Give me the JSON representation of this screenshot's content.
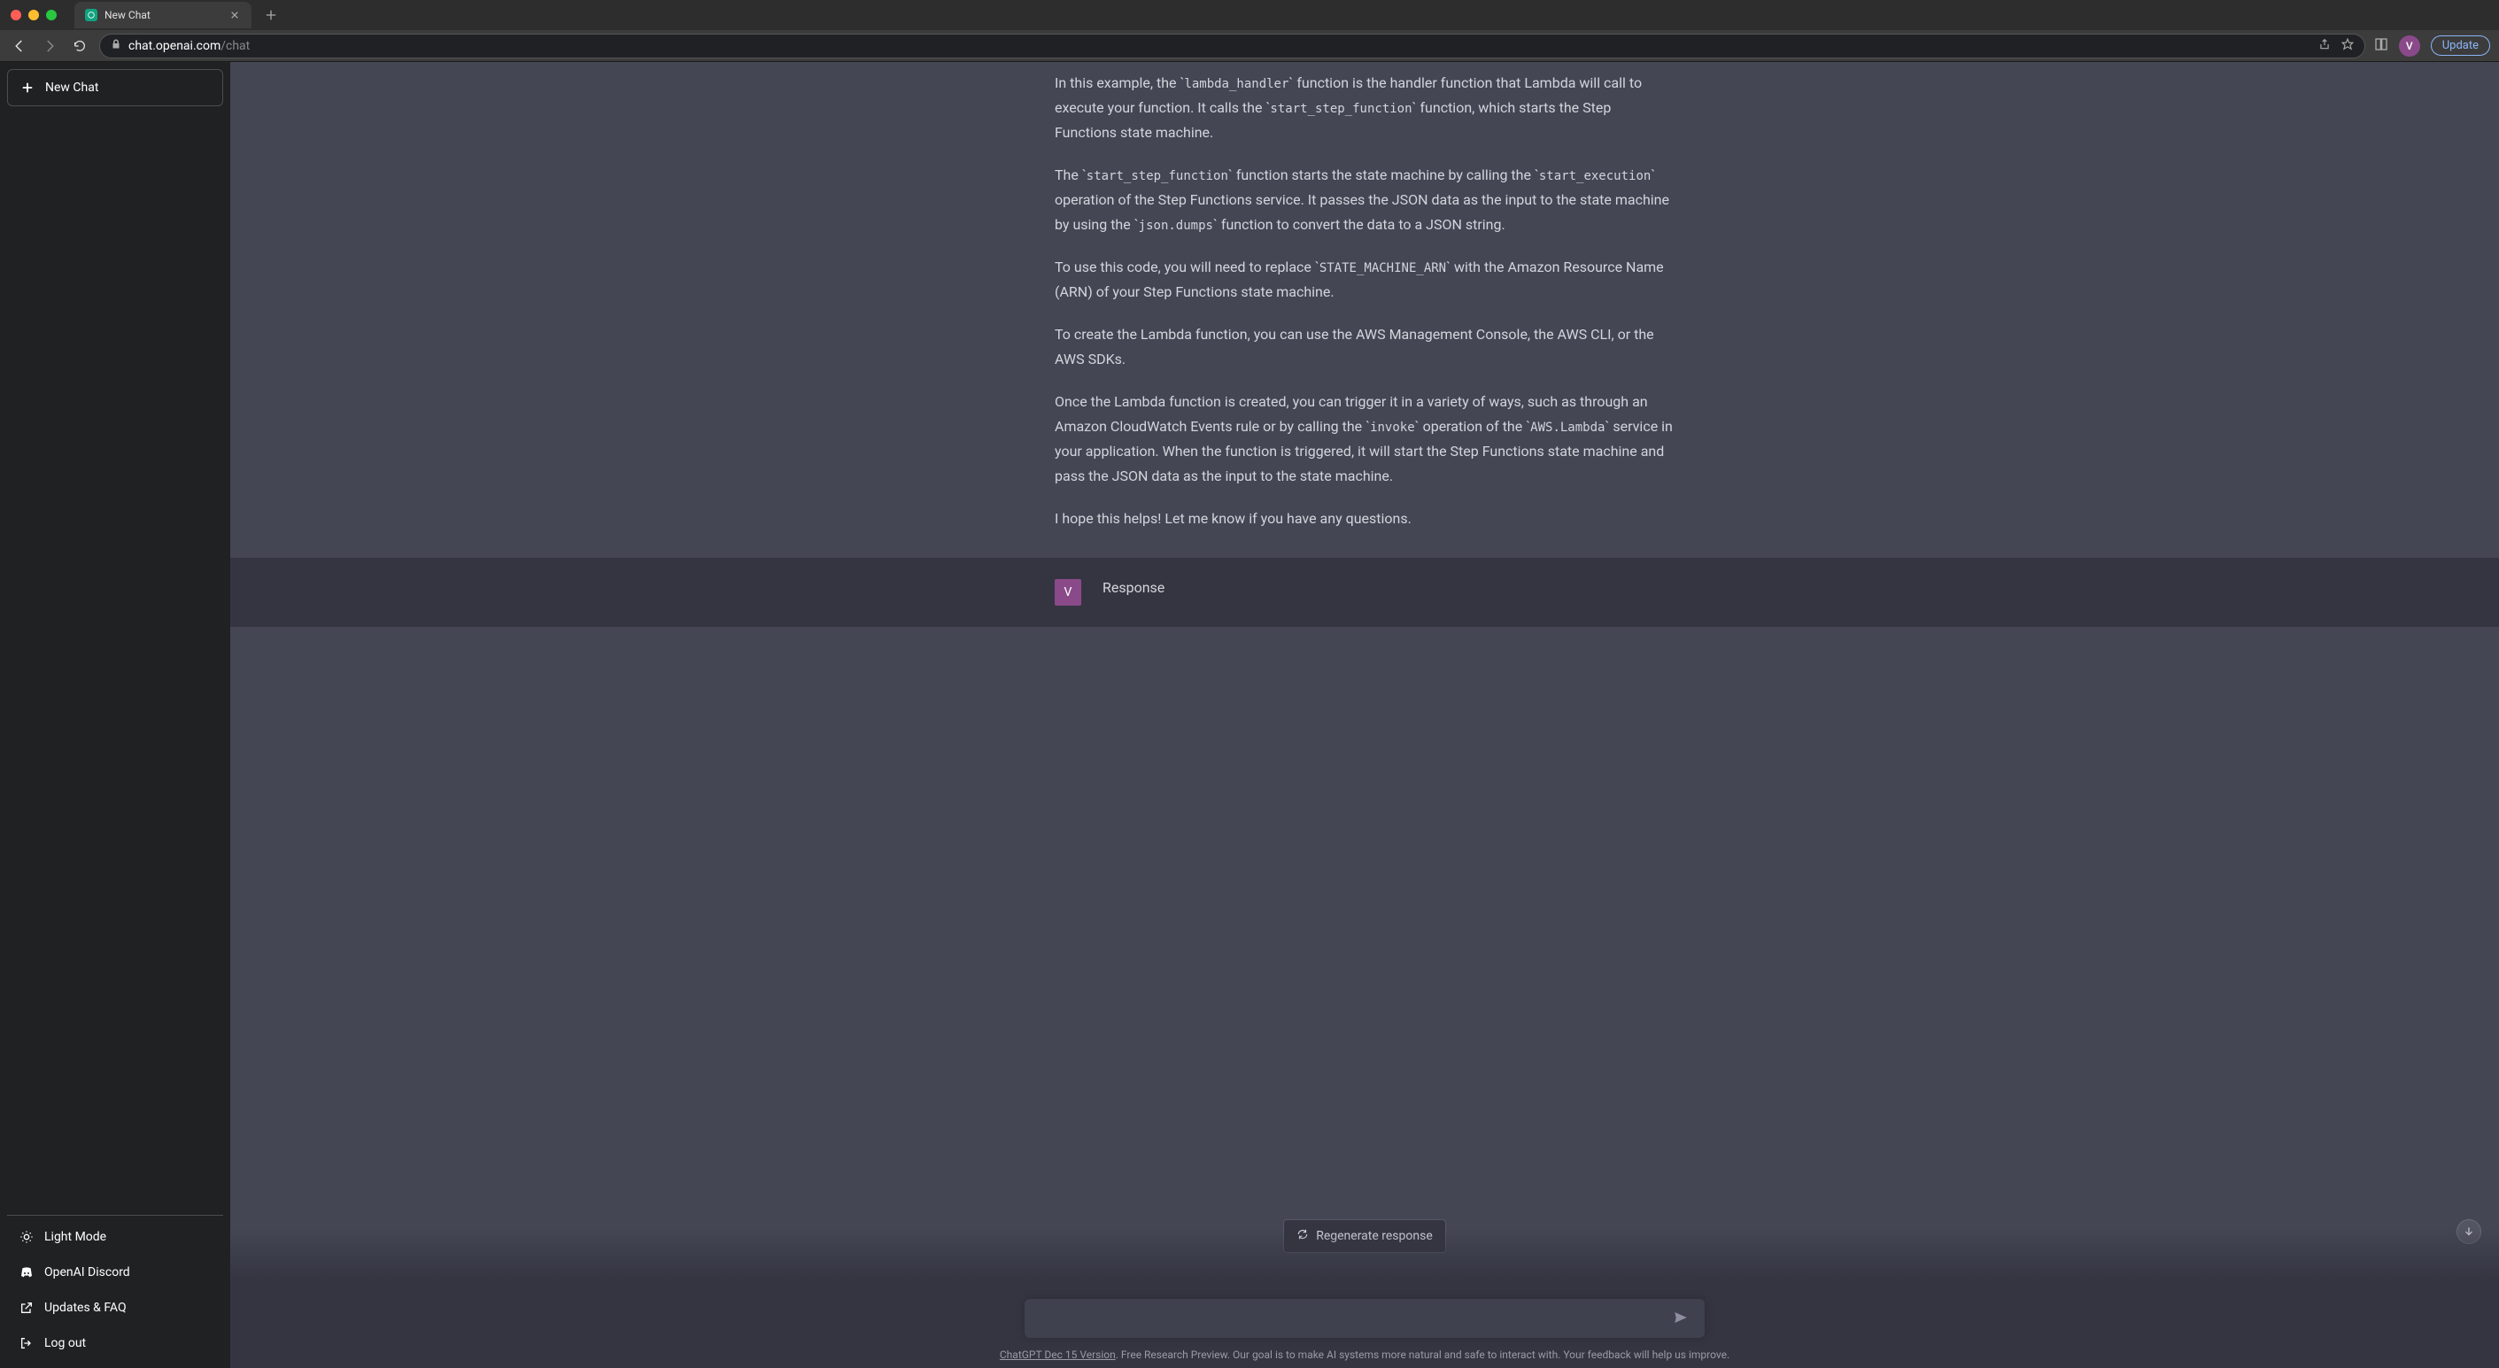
{
  "browser": {
    "tab_title": "New Chat",
    "url_domain": "chat.openai.com",
    "url_path": "/chat",
    "avatar_letter": "V",
    "update_label": "Update"
  },
  "sidebar": {
    "new_chat_label": "New Chat",
    "items": [
      {
        "label": "Light Mode"
      },
      {
        "label": "OpenAI Discord"
      },
      {
        "label": "Updates & FAQ"
      },
      {
        "label": "Log out"
      }
    ]
  },
  "chat": {
    "p1_a": "In this example, the ",
    "c1": "lambda_handler",
    "p1_b": " function is the handler function that Lambda will call to execute your function. It calls the ",
    "c2": "start_step_function",
    "p1_c": " function, which starts the Step Functions state machine.",
    "p2_a": "The ",
    "c3": "start_step_function",
    "p2_b": " function starts the state machine by calling the ",
    "c4": "start_execution",
    "p2_c": " operation of the Step Functions service. It passes the JSON data as the input to the state machine by using the ",
    "c5": "json.dumps",
    "p2_d": " function to convert the data to a JSON string.",
    "p3_a": "To use this code, you will need to replace ",
    "c6": "STATE_MACHINE_ARN",
    "p3_b": " with the Amazon Resource Name (ARN) of your Step Functions state machine.",
    "p4": "To create the Lambda function, you can use the AWS Management Console, the AWS CLI, or the AWS SDKs.",
    "p5_a": "Once the Lambda function is created, you can trigger it in a variety of ways, such as through an Amazon CloudWatch Events rule or by calling the ",
    "c7": "invoke",
    "p5_b": " operation of the ",
    "c8": "AWS.Lambda",
    "p5_c": " service in your application. When the function is triggered, it will start the Step Functions state machine and pass the JSON data as the input to the state machine.",
    "p6": "I hope this helps! Let me know if you have any questions."
  },
  "user_message": {
    "avatar_letter": "V",
    "text": "Response"
  },
  "controls": {
    "regenerate_label": "Regenerate response",
    "input_placeholder": ""
  },
  "footer": {
    "link_text": "ChatGPT Dec 15 Version",
    "rest": ". Free Research Preview. Our goal is to make AI systems more natural and safe to interact with. Your feedback will help us improve."
  }
}
